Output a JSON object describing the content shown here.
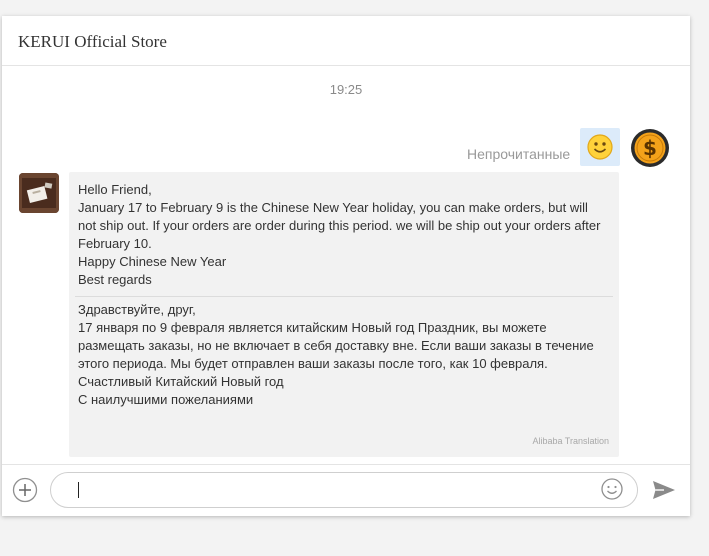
{
  "header": {
    "store_name": "KERUI Official Store"
  },
  "chat": {
    "timestamp": "19:25",
    "outgoing": {
      "unread_label": "Непрочитанные",
      "emoji_icon": "smiley-icon",
      "status_icon": "dollar-coin-icon"
    },
    "incoming": {
      "avatar": "store-avatar",
      "original_text": "Hello Friend,\nJanuary 17 to February 9  is the Chinese New Year holiday, you can make orders, but will not ship out. If your orders are order during this period. we will be ship out your orders after February 10.\nHappy Chinese New Year\nBest regards",
      "translated_text": "Здравствуйте, друг,\n17 января по 9 февраля является китайским Новый год Праздник, вы можете размещать заказы, но не включает в себя доставку вне. Если ваши заказы в течение этого периода. Мы будет отправлен ваши заказы после того, как 10 февраля.\nСчастливый Китайский Новый год\nС наилучшими пожеланиями",
      "translation_credit": "Alibaba Translation"
    }
  },
  "composer": {
    "input_value": "",
    "add_icon": "plus-circle-icon",
    "emoji_icon": "smiley-outline-icon",
    "send_icon": "send-icon"
  },
  "colors": {
    "outgoing_bubble": "#dcebfa",
    "incoming_bubble": "#f2f2f2",
    "coin": "#f4a21a"
  }
}
